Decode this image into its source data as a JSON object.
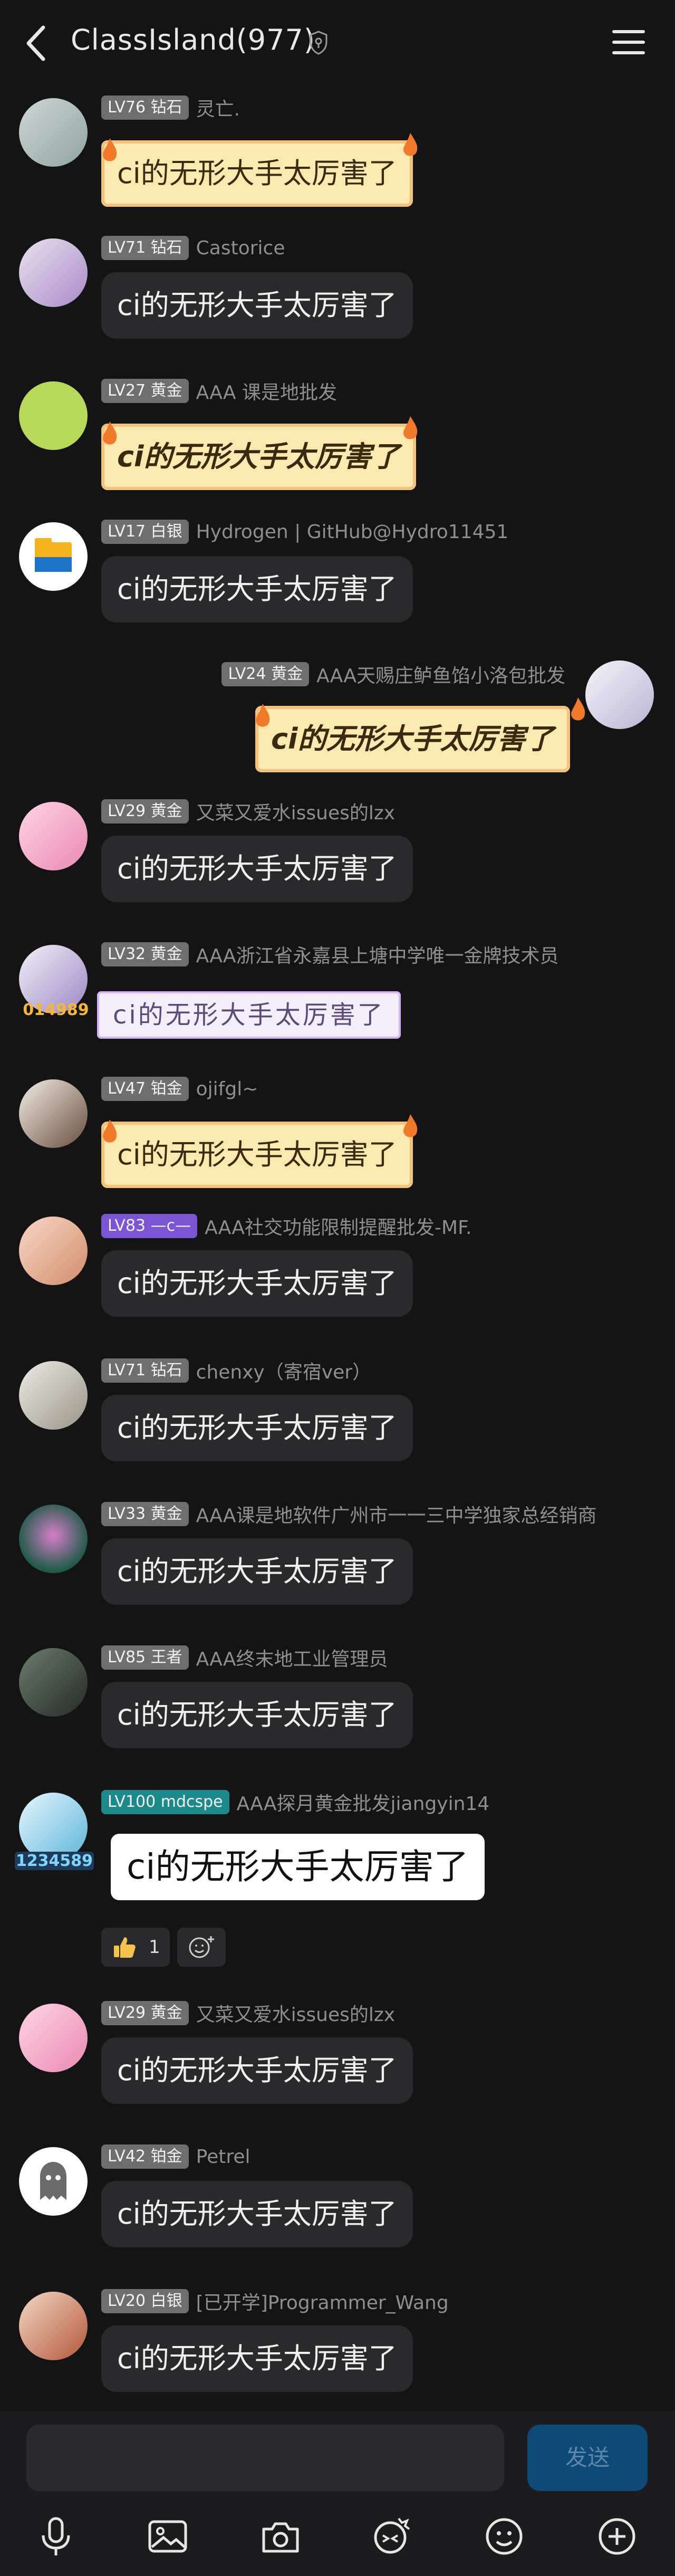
{
  "header": {
    "title": "ClassIsland(977)",
    "icons": [
      "back-arrow-icon",
      "shield-icon",
      "menu-icon"
    ]
  },
  "messages": [
    {
      "level": "LV76 钻石",
      "name": "灵亡.",
      "text": "ci的无形大手太厉害了",
      "style": "fire"
    },
    {
      "level": "LV71 钻石",
      "name": "Castorice",
      "text": "ci的无形大手太厉害了",
      "style": "dark"
    },
    {
      "level": "LV27 黄金",
      "name": "AAA 课是地批发",
      "text": "ci的无形大手太厉害了",
      "style": "fire-bold"
    },
    {
      "level": "LV17 白银",
      "name": "Hydrogen | GitHub@Hydro11451",
      "text": "ci的无形大手太厉害了",
      "style": "dark"
    },
    {
      "level": "LV24 黄金",
      "name": "AAA天赐庄鲈鱼馅小洛包批发",
      "text": "ci的无形大手太厉害了",
      "style": "fire-bold",
      "self": true
    },
    {
      "level": "LV29 黄金",
      "name": "又菜又爱水issues的lzx",
      "text": "ci的无形大手太厉害了",
      "style": "dark"
    },
    {
      "level": "LV32 黄金",
      "name": "AAA浙江省永嘉县上塘中学唯一金牌技术员",
      "text": "ci的无形大手太厉害了",
      "style": "lilac",
      "frame_number": "014989"
    },
    {
      "level": "LV47 铂金",
      "name": "ojifgl~",
      "text": "ci的无形大手太厉害了",
      "style": "fire"
    },
    {
      "level": "LV83 —c—",
      "name": "AAA社交功能限制提醒批发-MF.",
      "text": "ci的无形大手太厉害了",
      "style": "dark"
    },
    {
      "level": "LV71 钻石",
      "name": "chenxy（寄宿ver）",
      "text": "ci的无形大手太厉害了",
      "style": "dark"
    },
    {
      "level": "LV33 黄金",
      "name": "AAA课是地软件广州市一一三中学独家总经销商",
      "text": "ci的无形大手太厉害了",
      "style": "dark"
    },
    {
      "level": "LV85 王者",
      "name": "AAA终末地工业管理员",
      "text": "ci的无形大手太厉害了",
      "style": "dark"
    },
    {
      "level": "LV100 mdcspe",
      "name": "AAA探月黄金批发jiangyin14",
      "text": "ci的无形大手太厉害了",
      "style": "white",
      "frame_number": "1234589",
      "reaction_count": "1"
    },
    {
      "level": "LV29 黄金",
      "name": "又菜又爱水issues的lzx",
      "text": "ci的无形大手太厉害了",
      "style": "dark"
    },
    {
      "level": "LV42 铂金",
      "name": "Petrel",
      "text": "ci的无形大手太厉害了",
      "style": "dark"
    },
    {
      "level": "LV20 白银",
      "name": "[已开学]Programmer_Wang",
      "text": "ci的无形大手太厉害了",
      "style": "dark"
    }
  ],
  "composer": {
    "send_label": "发送",
    "tools": [
      "microphone-icon",
      "image-icon",
      "camera-icon",
      "sticker-icon",
      "emoji-icon",
      "plus-icon"
    ]
  },
  "colors": {
    "background": "#141414",
    "bubble": "#2a2a2c",
    "badge": "#6e6e6e",
    "send_button": "#0e4a78"
  }
}
